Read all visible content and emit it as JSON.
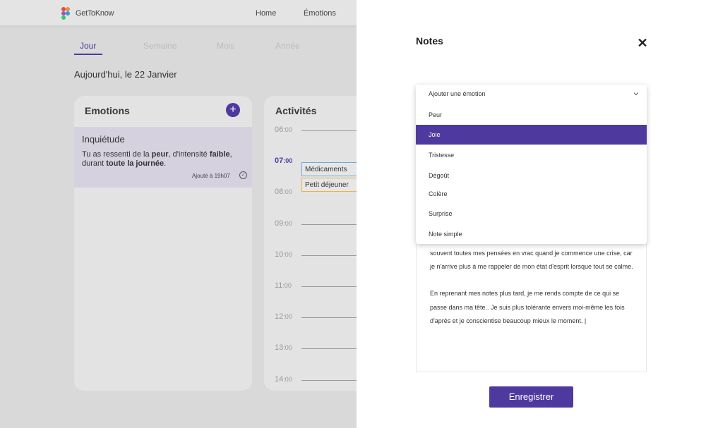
{
  "header": {
    "brand": "GetToKnow",
    "nav": [
      "Home",
      "Émotions"
    ]
  },
  "tabs": [
    "Jour",
    "Semaine",
    "Mois",
    "Année"
  ],
  "date_line": "Aujourd'hui, le 22 Janvier",
  "emotions_card": {
    "title": "Emotions",
    "add_symbol": "+",
    "entry": {
      "name": "Inquiétude",
      "desc_1": "Tu as ressenti de la ",
      "desc_2": "peur",
      "desc_3": ", d'intensité ",
      "desc_4": "faible",
      "desc_5": ",",
      "desc_6": "durant ",
      "desc_7": "toute la journée",
      "desc_8": ".",
      "added": "Ajouté à 19h07"
    }
  },
  "activities_card": {
    "title": "Activités",
    "times": [
      {
        "h": "06",
        "m": ":00"
      },
      {
        "h": "07",
        "m": ":00"
      },
      {
        "h": "08",
        "m": ":00"
      },
      {
        "h": "09",
        "m": ":00"
      },
      {
        "h": "10",
        "m": ":00"
      },
      {
        "h": "11",
        "m": ":00"
      },
      {
        "h": "12",
        "m": ":00"
      },
      {
        "h": "13",
        "m": ":00"
      },
      {
        "h": "14",
        "m": ":00"
      }
    ],
    "activities": [
      {
        "label": "Médicaments",
        "color": "#6fa8dc"
      },
      {
        "label": "Petit déjeuner",
        "color": "#e0b84a"
      }
    ]
  },
  "notes_panel": {
    "title": "Notes",
    "close_symbol": "✕",
    "dropdown": {
      "placeholder": "Ajouter une émotion",
      "options": [
        "Peur",
        "Joie",
        "Tristesse",
        "Dégoût",
        "Colère",
        "Surprise",
        "Note simple"
      ],
      "selected": "Joie"
    },
    "note_paragraph_1": "souvent toutes mes pensées en vrac quand je commence une crise, car je n'arrive plus à me rappeler de mon état d'esprit lorsque tout se calme.",
    "note_paragraph_2": "En reprenant mes notes plus tard, je me rends compte de ce qui se passe dans ma tête.. Je suis plus tolérante envers moi-même les fois d'après et je conscientise beaucoup mieux le moment.   |",
    "save_label": "Enregistrer"
  },
  "colors": {
    "accent": "#4e3a9f",
    "overlay_bg": "#d9d9d9"
  }
}
